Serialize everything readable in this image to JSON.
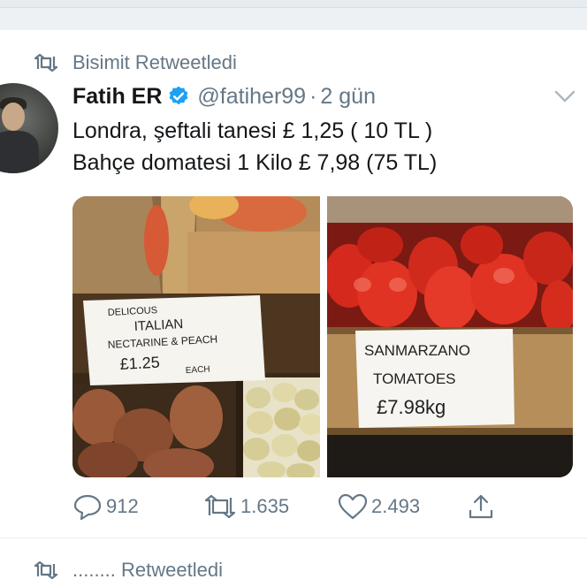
{
  "retweet_context": {
    "icon": "retweet-icon",
    "label": "Bisimit Retweetledi"
  },
  "author": {
    "name": "Fatih ER",
    "handle": "@fatiher99",
    "separator": "·",
    "time": "2 gün",
    "verified": true
  },
  "tweet_text": {
    "line1": "Londra, şeftali tanesi £ 1,25 ( 10 TL )",
    "line2": "Bahçe domatesi 1 Kilo £ 7,98 (75 TL)"
  },
  "media": {
    "left_sign": {
      "line1": "DELICOUS",
      "line2": "ITALIAN",
      "line3": "NECTARINE & PEACH",
      "line4": "£1.25",
      "line5": "EACH"
    },
    "right_sign": {
      "line1": "SANMARZANO",
      "line2": "TOMATOES",
      "line3": "£7.98kg"
    }
  },
  "actions": {
    "reply_count": "912",
    "retweet_count": "1.635",
    "like_count": "2.493"
  },
  "next_item": {
    "label": "........ Retweetledi"
  },
  "colors": {
    "accent": "#1da1f2",
    "muted": "#657786",
    "text": "#14171a"
  }
}
